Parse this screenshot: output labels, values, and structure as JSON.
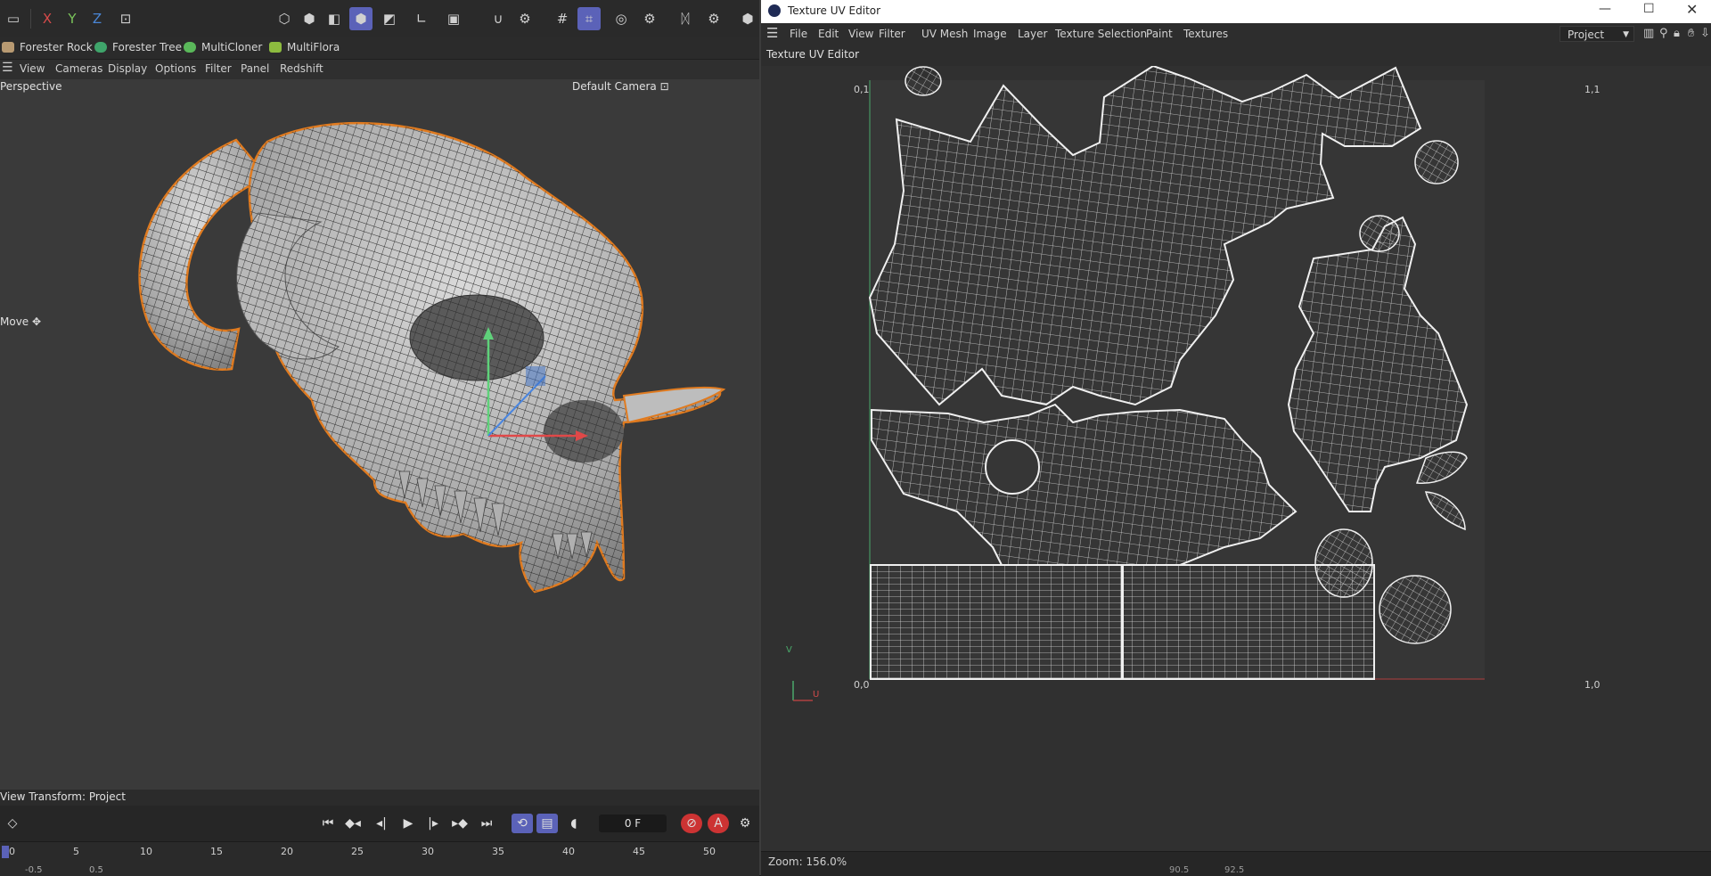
{
  "left": {
    "toolbar": {
      "axis_labels": [
        "X",
        "Y",
        "Z"
      ],
      "colors": {
        "x": "#d64a4a",
        "y": "#7ac55a",
        "z": "#4a86d6",
        "active": "#5b62b8"
      }
    },
    "plugins": [
      "Forester Rock",
      "Forester Tree",
      "MultiCloner",
      "MultiFlora"
    ],
    "viewport_menu": [
      "View",
      "Cameras",
      "Display",
      "Options",
      "Filter",
      "Panel",
      "Redshift"
    ],
    "viewport": {
      "name": "Perspective",
      "camera": "Default Camera",
      "camera_icon": "⊡",
      "tool": "Move",
      "tool_icon": "✥",
      "view_transform": "View Transform: Project"
    },
    "transport": {
      "frame": "0 F"
    },
    "timeline": {
      "ticks": [
        "0",
        "5",
        "10",
        "15",
        "20",
        "25",
        "30",
        "35",
        "40",
        "45",
        "50"
      ],
      "bottom_labels": [
        "-0.5",
        "0.5"
      ]
    }
  },
  "right": {
    "window_title": "Texture UV Editor",
    "menu": [
      "File",
      "Edit",
      "View",
      "Filter",
      "UV Mesh",
      "Image",
      "Layer",
      "Texture Selection",
      "Paint",
      "Textures"
    ],
    "project_select": "Project",
    "panel_title": "Texture UV Editor",
    "corners": {
      "tl": "0,1",
      "tr": "1,1",
      "bl": "0,0",
      "br": "1,0"
    },
    "axis": {
      "v": "V",
      "u": "U"
    },
    "zoom": "Zoom: 156.0%",
    "bottom_labels": [
      "90.5",
      "92.5"
    ]
  }
}
